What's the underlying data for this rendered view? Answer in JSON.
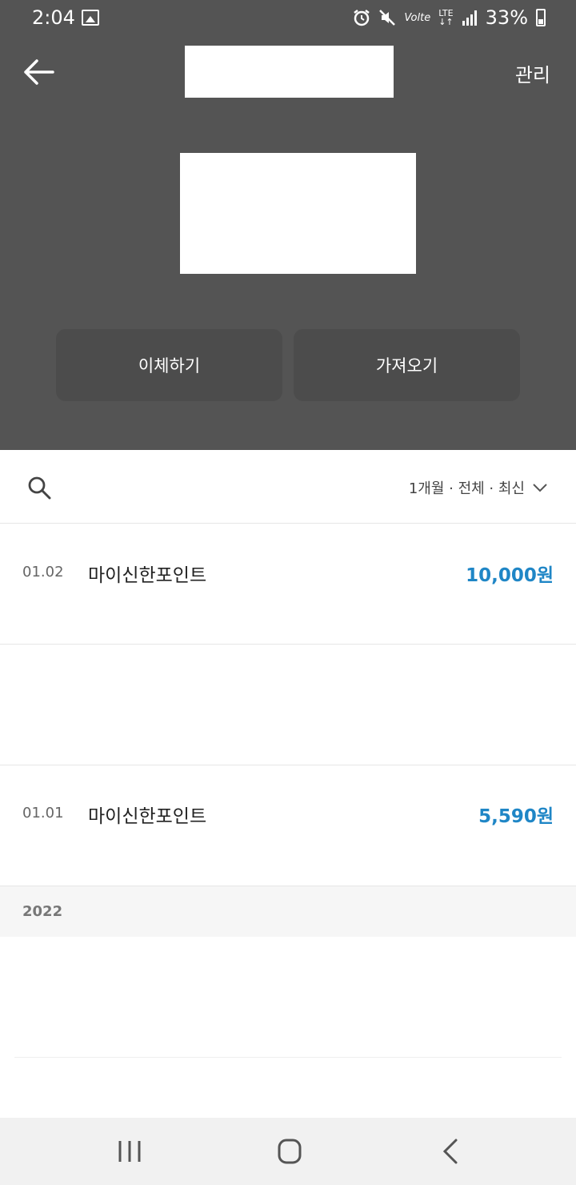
{
  "status_bar": {
    "time": "2:04",
    "network_label": "Volte",
    "lte_label": "LTE",
    "battery": "33%",
    "icons": [
      "gallery-icon",
      "alarm-icon",
      "mute-icon",
      "signal-icon",
      "battery-icon"
    ]
  },
  "header": {
    "back_icon": "arrow-left-icon",
    "manage_label": "관리"
  },
  "actions": {
    "transfer_label": "이체하기",
    "import_label": "가져오기"
  },
  "filter": {
    "search_icon": "search-icon",
    "summary": "1개월 · 전체 · 최신",
    "dropdown_icon": "chevron-down-icon"
  },
  "transactions": [
    {
      "date": "01.02",
      "name": "마이신한포인트",
      "amount": "10,000원"
    },
    {
      "date": "01.01",
      "name": "마이신한포인트",
      "amount": "5,590원"
    }
  ],
  "year_section": {
    "year": "2022"
  },
  "colors": {
    "header_bg": "#545454",
    "button_bg": "#4c4c4c",
    "amount_accent": "#1f86c6"
  },
  "nav_bar": {
    "icons": [
      "recents-icon",
      "home-icon",
      "back-icon"
    ]
  }
}
